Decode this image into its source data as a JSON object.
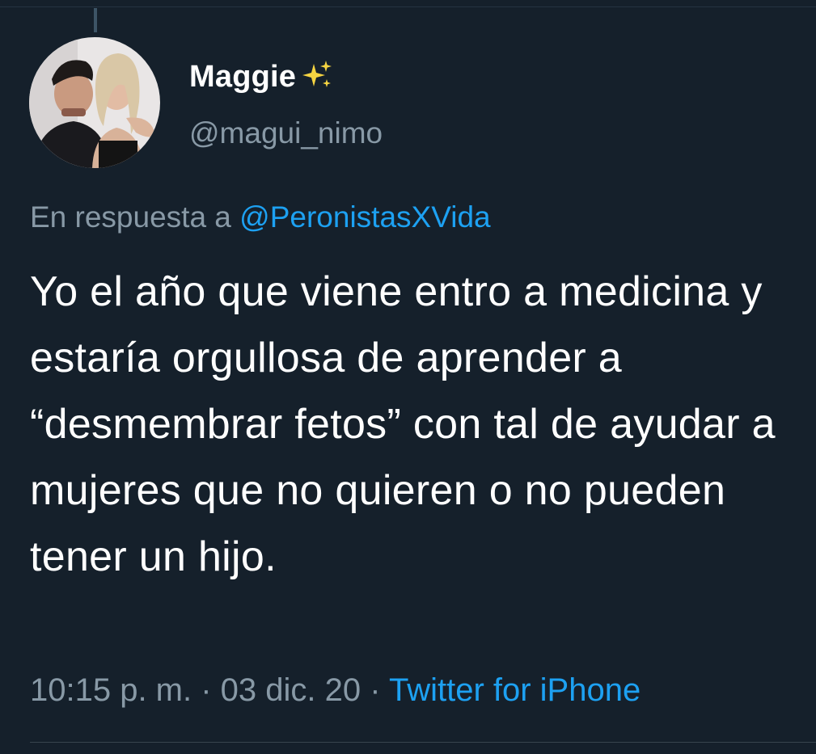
{
  "tweet": {
    "display_name": "Maggie",
    "display_name_icon": "sparkles-icon",
    "handle": "@magui_nimo",
    "avatar_icon": "avatar-photo",
    "reply_prefix": "En respuesta a",
    "reply_to": "@PeronistasXVida",
    "text": "Yo el año que viene entro a medicina y estaría orgullosa de aprender a “desmembrar fetos” con tal de ayudar a mujeres que no quieren o no pueden tener un hijo.",
    "time": "10:15 p. m.",
    "date": "03 dic. 20",
    "source": "Twitter for iPhone",
    "separator": " · "
  },
  "colors": {
    "background": "#15202b",
    "primary_text": "#ffffff",
    "secondary_text": "#8899a6",
    "link": "#1da1f2",
    "sparkle": "#f5d442"
  }
}
